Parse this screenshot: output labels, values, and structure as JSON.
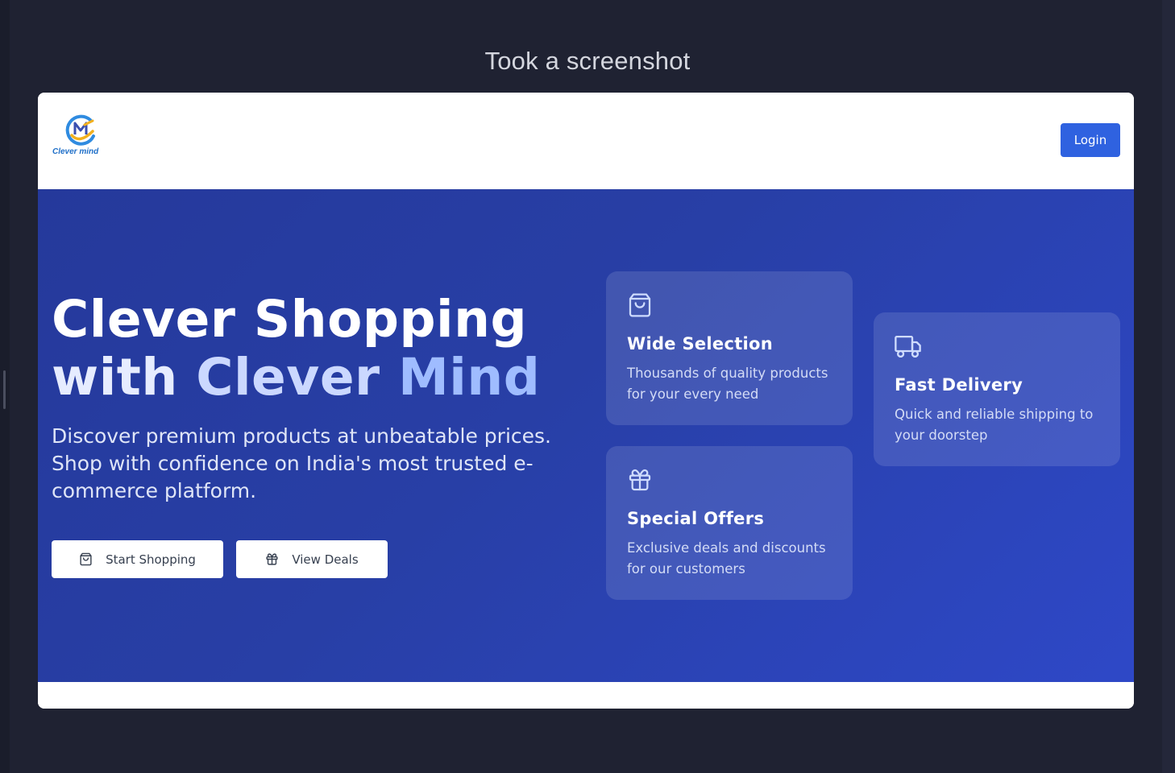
{
  "caption": "Took a screenshot",
  "navbar": {
    "logo_text": "Clever mind",
    "login_label": "Login"
  },
  "hero": {
    "title_line1": "Clever Shopping",
    "title_line2_a": "with",
    "title_line2_b": "Clever",
    "title_line2_c": "Mind",
    "description": "Discover premium products at unbeatable prices. Shop with confidence on India's most trusted e-commerce platform.",
    "buttons": {
      "start_label": "Start Shopping",
      "deals_label": "View Deals"
    }
  },
  "features": {
    "wide_selection": {
      "icon": "shopping-bag-icon",
      "title": "Wide Selection",
      "text": "Thousands of quality products for your every need"
    },
    "fast_delivery": {
      "icon": "truck-icon",
      "title": "Fast Delivery",
      "text": "Quick and reliable shipping to your doorstep"
    },
    "special_offers": {
      "icon": "gift-icon",
      "title": "Special Offers",
      "text": "Exclusive deals and discounts for our customers"
    }
  },
  "colors": {
    "page_background": "#1f2232",
    "hero_gradient_start": "#25399b",
    "hero_gradient_end": "#2e48c7",
    "primary_button": "#2f62e0",
    "title_accent": "#9fbcff"
  }
}
